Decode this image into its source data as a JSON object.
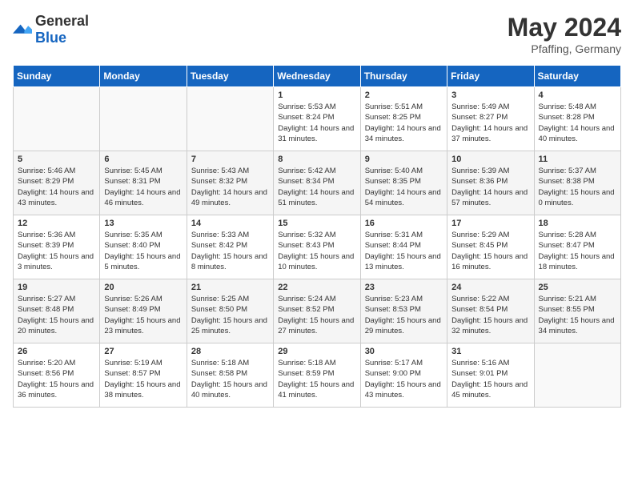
{
  "header": {
    "logo_general": "General",
    "logo_blue": "Blue",
    "month_year": "May 2024",
    "location": "Pfaffing, Germany"
  },
  "days_of_week": [
    "Sunday",
    "Monday",
    "Tuesday",
    "Wednesday",
    "Thursday",
    "Friday",
    "Saturday"
  ],
  "weeks": [
    [
      {
        "day": "",
        "info": ""
      },
      {
        "day": "",
        "info": ""
      },
      {
        "day": "",
        "info": ""
      },
      {
        "day": "1",
        "info": "Sunrise: 5:53 AM\nSunset: 8:24 PM\nDaylight: 14 hours and 31 minutes."
      },
      {
        "day": "2",
        "info": "Sunrise: 5:51 AM\nSunset: 8:25 PM\nDaylight: 14 hours and 34 minutes."
      },
      {
        "day": "3",
        "info": "Sunrise: 5:49 AM\nSunset: 8:27 PM\nDaylight: 14 hours and 37 minutes."
      },
      {
        "day": "4",
        "info": "Sunrise: 5:48 AM\nSunset: 8:28 PM\nDaylight: 14 hours and 40 minutes."
      }
    ],
    [
      {
        "day": "5",
        "info": "Sunrise: 5:46 AM\nSunset: 8:29 PM\nDaylight: 14 hours and 43 minutes."
      },
      {
        "day": "6",
        "info": "Sunrise: 5:45 AM\nSunset: 8:31 PM\nDaylight: 14 hours and 46 minutes."
      },
      {
        "day": "7",
        "info": "Sunrise: 5:43 AM\nSunset: 8:32 PM\nDaylight: 14 hours and 49 minutes."
      },
      {
        "day": "8",
        "info": "Sunrise: 5:42 AM\nSunset: 8:34 PM\nDaylight: 14 hours and 51 minutes."
      },
      {
        "day": "9",
        "info": "Sunrise: 5:40 AM\nSunset: 8:35 PM\nDaylight: 14 hours and 54 minutes."
      },
      {
        "day": "10",
        "info": "Sunrise: 5:39 AM\nSunset: 8:36 PM\nDaylight: 14 hours and 57 minutes."
      },
      {
        "day": "11",
        "info": "Sunrise: 5:37 AM\nSunset: 8:38 PM\nDaylight: 15 hours and 0 minutes."
      }
    ],
    [
      {
        "day": "12",
        "info": "Sunrise: 5:36 AM\nSunset: 8:39 PM\nDaylight: 15 hours and 3 minutes."
      },
      {
        "day": "13",
        "info": "Sunrise: 5:35 AM\nSunset: 8:40 PM\nDaylight: 15 hours and 5 minutes."
      },
      {
        "day": "14",
        "info": "Sunrise: 5:33 AM\nSunset: 8:42 PM\nDaylight: 15 hours and 8 minutes."
      },
      {
        "day": "15",
        "info": "Sunrise: 5:32 AM\nSunset: 8:43 PM\nDaylight: 15 hours and 10 minutes."
      },
      {
        "day": "16",
        "info": "Sunrise: 5:31 AM\nSunset: 8:44 PM\nDaylight: 15 hours and 13 minutes."
      },
      {
        "day": "17",
        "info": "Sunrise: 5:29 AM\nSunset: 8:45 PM\nDaylight: 15 hours and 16 minutes."
      },
      {
        "day": "18",
        "info": "Sunrise: 5:28 AM\nSunset: 8:47 PM\nDaylight: 15 hours and 18 minutes."
      }
    ],
    [
      {
        "day": "19",
        "info": "Sunrise: 5:27 AM\nSunset: 8:48 PM\nDaylight: 15 hours and 20 minutes."
      },
      {
        "day": "20",
        "info": "Sunrise: 5:26 AM\nSunset: 8:49 PM\nDaylight: 15 hours and 23 minutes."
      },
      {
        "day": "21",
        "info": "Sunrise: 5:25 AM\nSunset: 8:50 PM\nDaylight: 15 hours and 25 minutes."
      },
      {
        "day": "22",
        "info": "Sunrise: 5:24 AM\nSunset: 8:52 PM\nDaylight: 15 hours and 27 minutes."
      },
      {
        "day": "23",
        "info": "Sunrise: 5:23 AM\nSunset: 8:53 PM\nDaylight: 15 hours and 29 minutes."
      },
      {
        "day": "24",
        "info": "Sunrise: 5:22 AM\nSunset: 8:54 PM\nDaylight: 15 hours and 32 minutes."
      },
      {
        "day": "25",
        "info": "Sunrise: 5:21 AM\nSunset: 8:55 PM\nDaylight: 15 hours and 34 minutes."
      }
    ],
    [
      {
        "day": "26",
        "info": "Sunrise: 5:20 AM\nSunset: 8:56 PM\nDaylight: 15 hours and 36 minutes."
      },
      {
        "day": "27",
        "info": "Sunrise: 5:19 AM\nSunset: 8:57 PM\nDaylight: 15 hours and 38 minutes."
      },
      {
        "day": "28",
        "info": "Sunrise: 5:18 AM\nSunset: 8:58 PM\nDaylight: 15 hours and 40 minutes."
      },
      {
        "day": "29",
        "info": "Sunrise: 5:18 AM\nSunset: 8:59 PM\nDaylight: 15 hours and 41 minutes."
      },
      {
        "day": "30",
        "info": "Sunrise: 5:17 AM\nSunset: 9:00 PM\nDaylight: 15 hours and 43 minutes."
      },
      {
        "day": "31",
        "info": "Sunrise: 5:16 AM\nSunset: 9:01 PM\nDaylight: 15 hours and 45 minutes."
      },
      {
        "day": "",
        "info": ""
      }
    ]
  ]
}
